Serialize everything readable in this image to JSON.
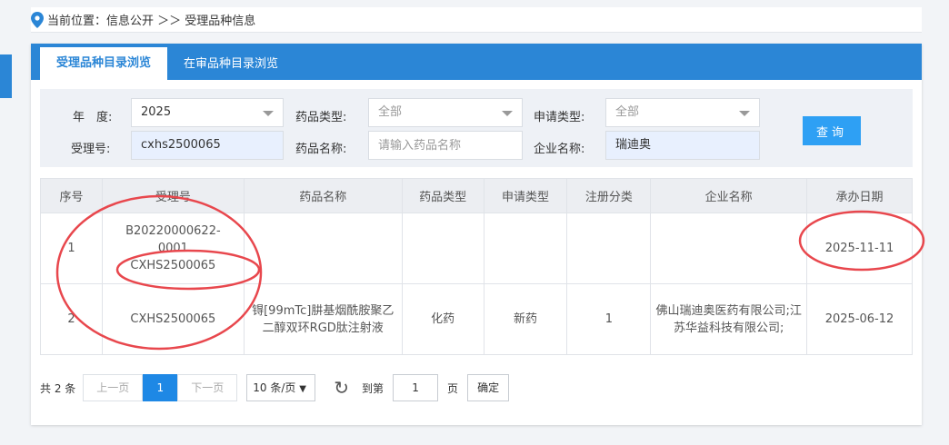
{
  "breadcrumb": {
    "label": "当前位置：信息公开 ＞＞ 受理品种信息"
  },
  "tabs": [
    {
      "label": "受理品种目录浏览"
    },
    {
      "label": "在审品种目录浏览"
    }
  ],
  "filters": {
    "year": {
      "label": "年　度:",
      "value": "2025"
    },
    "drug_type": {
      "label": "药品类型:",
      "value": "全部"
    },
    "apply_type": {
      "label": "申请类型:",
      "value": "全部"
    },
    "accept_no": {
      "label": "受理号:",
      "value": "cxhs2500065"
    },
    "drug_name": {
      "label": "药品名称:",
      "placeholder": "请输入药品名称"
    },
    "company": {
      "label": "企业名称:",
      "value": "瑞迪奥"
    },
    "query_button": "查询"
  },
  "table": {
    "headers": [
      "序号",
      "受理号",
      "药品名称",
      "药品类型",
      "申请类型",
      "注册分类",
      "企业名称",
      "承办日期"
    ],
    "rows": [
      {
        "no": "1",
        "accept_line1": "B20220000622-",
        "accept_line2": "0001",
        "accept_line3": "CXHS2500065",
        "name": "",
        "drug_type": "",
        "apply_type": "",
        "reg_class": "",
        "company": "",
        "date": "2025-11-11"
      },
      {
        "no": "2",
        "accept_line1": "CXHS2500065",
        "name": "锝[99mTc]肼基烟酰胺聚乙二醇双环RGD肽注射液",
        "drug_type": "化药",
        "apply_type": "新药",
        "reg_class": "1",
        "company": "佛山瑞迪奥医药有限公司;江苏华益科技有限公司;",
        "date": "2025-06-12"
      }
    ]
  },
  "pager": {
    "total": "共 2 条",
    "prev": "上一页",
    "current": "1",
    "next": "下一页",
    "page_size": "10 条/页",
    "goto_label": "到第",
    "goto_value": "1",
    "page_unit": "页",
    "confirm": "确定"
  },
  "colors": {
    "accent": "#2b86d6",
    "annotation": "#e8474d"
  }
}
